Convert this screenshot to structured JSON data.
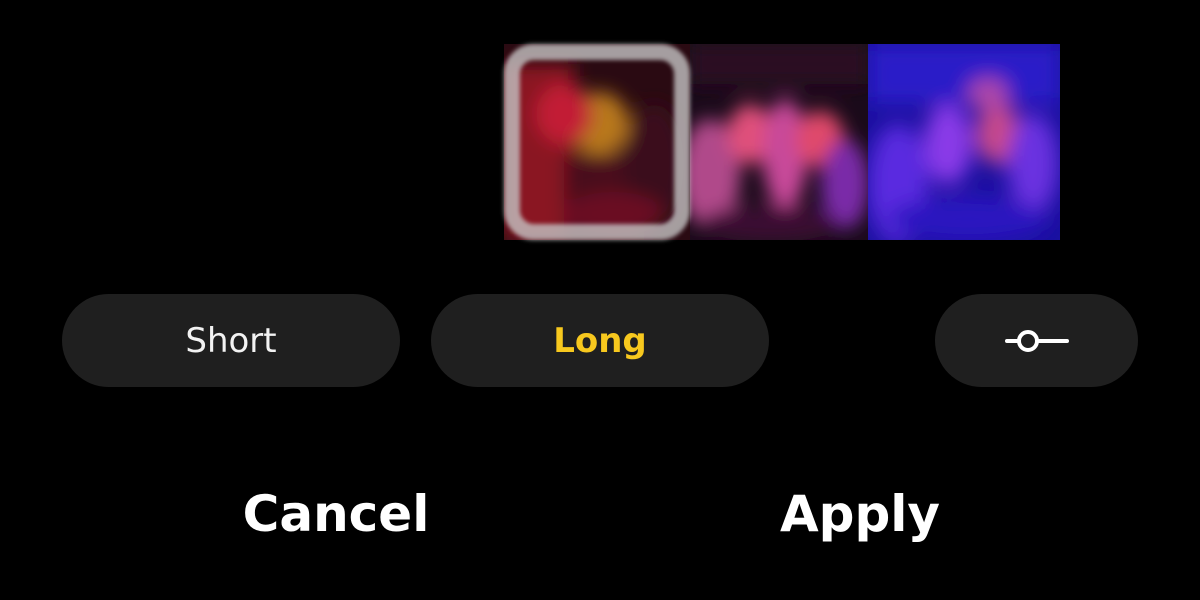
{
  "thumbnails": [
    {
      "name": "thumbnail-1",
      "selected": true,
      "tint": "#a0182a"
    },
    {
      "name": "thumbnail-2",
      "selected": false,
      "tint": "#7a2a6e"
    },
    {
      "name": "thumbnail-3",
      "selected": false,
      "tint": "#3a22d8"
    }
  ],
  "modes": {
    "short_label": "Short",
    "long_label": "Long",
    "selected": "Long"
  },
  "adjust": {
    "icon": "slider-adjust-icon"
  },
  "actions": {
    "cancel_label": "Cancel",
    "apply_label": "Apply"
  },
  "colors": {
    "background": "#000000",
    "pill_background": "#1f1f1f",
    "accent": "#f7c81e",
    "text": "#ffffff"
  }
}
